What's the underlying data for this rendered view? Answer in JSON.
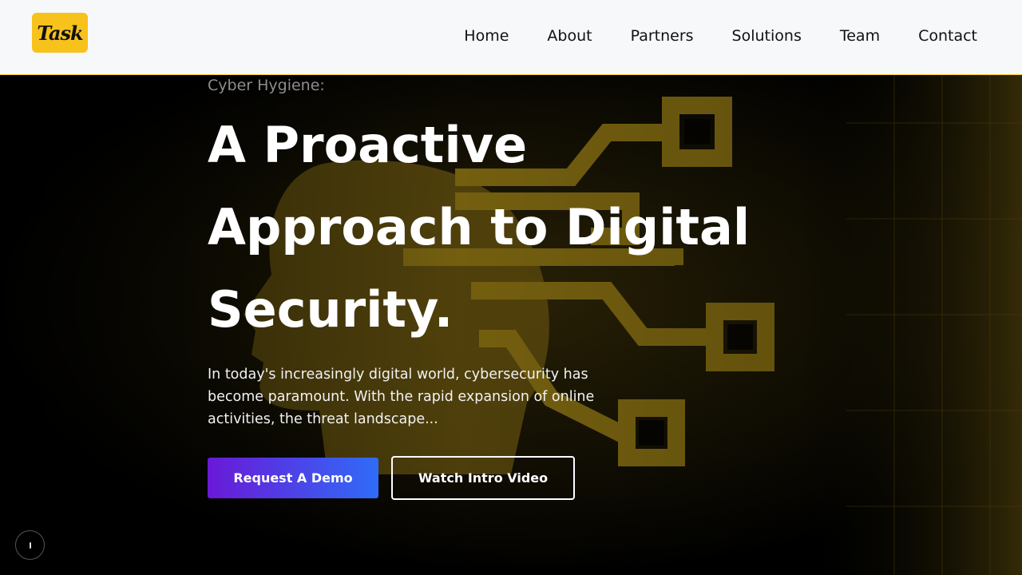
{
  "nav": {
    "logo_text": "Task",
    "links": [
      "Home",
      "About",
      "Partners",
      "Solutions",
      "Team",
      "Contact"
    ]
  },
  "hero": {
    "eyebrow": "Cyber Hygiene:",
    "headline": [
      "A Proactive",
      "Approach to Digital",
      "Security."
    ],
    "description": "In today's increasingly digital world, cybersecurity has become paramount. With the rapid expansion of online activities, the threat landscape...",
    "primary_button": "Request A Demo",
    "secondary_button": "Watch Intro Video",
    "background_icon": "circuit-head-icon"
  },
  "colors": {
    "accent": "#f7c21b",
    "nav_bg": "#f7f8fa",
    "hero_bg": "#000000",
    "button_gradient_start": "#6a19d6",
    "button_gradient_end": "#2f6cf8",
    "graphic": "#7a6410"
  }
}
